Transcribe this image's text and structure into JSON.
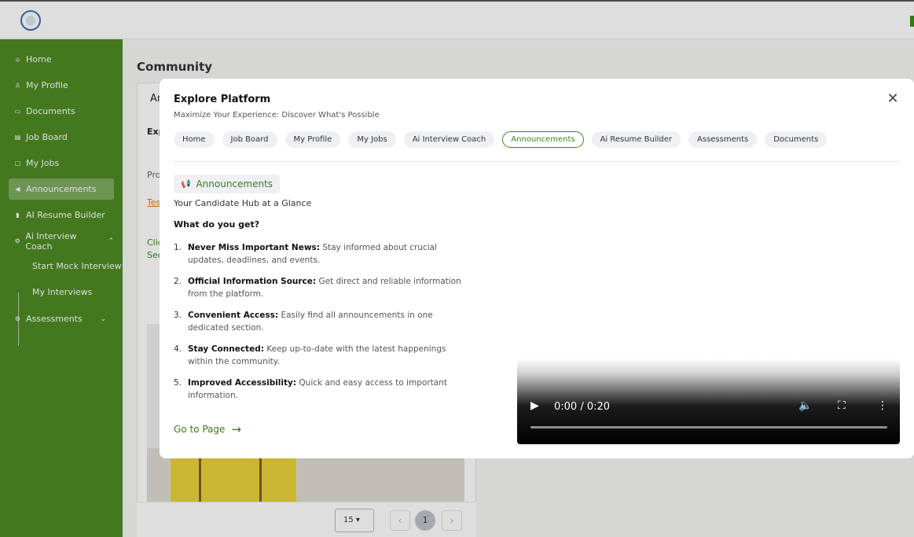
{
  "app": {
    "page_title": "Community"
  },
  "sidebar": {
    "items": [
      {
        "label": "Home",
        "icon": "home-icon"
      },
      {
        "label": "My Profile",
        "icon": "user-icon"
      },
      {
        "label": "Documents",
        "icon": "folder-icon"
      },
      {
        "label": "Job Board",
        "icon": "board-icon"
      },
      {
        "label": "My Jobs",
        "icon": "briefcase-icon"
      },
      {
        "label": "Announcements",
        "icon": "megaphone-icon"
      },
      {
        "label": "AI Resume Builder",
        "icon": "document-icon"
      },
      {
        "label": "Ai Interview Coach",
        "icon": "gear-icon"
      },
      {
        "label": "Assessments",
        "icon": "gear-icon"
      }
    ],
    "subitems": [
      "Start Mock Interview",
      "My Interviews"
    ]
  },
  "background_card": {
    "tab_fragment": "An",
    "exp_fragment": "Exp",
    "broken_image_alt": "Pro",
    "link_fragment": "Tes",
    "green_line1": "Clic",
    "green_line2": "Sec"
  },
  "pagination": {
    "per_page": "15",
    "current_page": "1"
  },
  "modal": {
    "title": "Explore Platform",
    "subtitle": "Maximize Your Experience: Discover What's Possible",
    "tabs": [
      "Home",
      "Job Board",
      "My Profile",
      "My Jobs",
      "Ai Interview Coach",
      "Announcements",
      "Ai Resume Builder",
      "Assessments",
      "Documents"
    ],
    "active_tab": "Announcements",
    "section_badge": "Announcements",
    "tagline": "Your Candidate Hub at a Glance",
    "what_heading": "What do you get?",
    "features": [
      {
        "num": "1.",
        "title": "Never Miss Important News:",
        "text": "Stay informed about crucial updates, deadlines, and events."
      },
      {
        "num": "2.",
        "title": "Official Information Source:",
        "text": "Get direct and reliable information from the platform."
      },
      {
        "num": "3.",
        "title": "Convenient Access:",
        "text": "Easily find all announcements in one dedicated section."
      },
      {
        "num": "4.",
        "title": "Stay Connected:",
        "text": "Keep up-to-date with the latest happenings within the community."
      },
      {
        "num": "5.",
        "title": "Improved Accessibility:",
        "text": "Quick and easy access to important information."
      }
    ],
    "cta": "Go to Page",
    "video": {
      "time": "0:00 / 0:20",
      "progress_fraction": 0
    }
  },
  "colors": {
    "sidebar_green": "#4e8a23",
    "accent_green": "#3a8a1a",
    "tab_bg": "#eef0f4"
  }
}
